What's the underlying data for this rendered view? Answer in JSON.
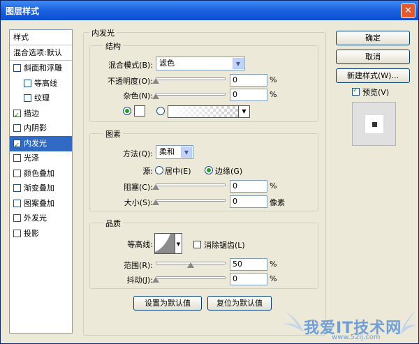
{
  "window": {
    "title": "图层样式",
    "close_glyph": "✕"
  },
  "style_list": {
    "header": "样式",
    "blend_default": "混合选项:默认",
    "items": [
      {
        "label": "斜面和浮雕",
        "checked": false,
        "selected": false,
        "indent": false
      },
      {
        "label": "等高线",
        "checked": false,
        "selected": false,
        "indent": true
      },
      {
        "label": "纹理",
        "checked": false,
        "selected": false,
        "indent": true
      },
      {
        "label": "描边",
        "checked": true,
        "selected": false,
        "indent": false
      },
      {
        "label": "内阴影",
        "checked": false,
        "selected": false,
        "indent": false
      },
      {
        "label": "内发光",
        "checked": true,
        "selected": true,
        "indent": false
      },
      {
        "label": "光泽",
        "checked": false,
        "selected": false,
        "indent": false
      },
      {
        "label": "颜色叠加",
        "checked": false,
        "selected": false,
        "indent": false
      },
      {
        "label": "渐变叠加",
        "checked": false,
        "selected": false,
        "indent": false
      },
      {
        "label": "图案叠加",
        "checked": false,
        "selected": false,
        "indent": false
      },
      {
        "label": "外发光",
        "checked": false,
        "selected": false,
        "indent": false
      },
      {
        "label": "投影",
        "checked": false,
        "selected": false,
        "indent": false
      }
    ]
  },
  "inner_glow": {
    "title": "内发光",
    "structure": {
      "title": "结构",
      "blend_mode_label": "混合模式(B):",
      "blend_mode_value": "滤色",
      "opacity_label": "不透明度(O):",
      "opacity_value": "0",
      "opacity_level": 0,
      "noise_label": "杂色(N):",
      "noise_value": "0",
      "noise_level": 0,
      "percent": "%"
    },
    "elements": {
      "title": "图素",
      "technique_label": "方法(Q):",
      "technique_value": "柔和",
      "source_label": "源:",
      "source_center": "居中(E)",
      "source_edge": "边缘(G)",
      "choke_label": "阻塞(C):",
      "choke_value": "0",
      "choke_level": 0,
      "size_label": "大小(S):",
      "size_value": "0",
      "size_level": 0,
      "size_unit": "像素",
      "percent": "%"
    },
    "quality": {
      "title": "品质",
      "contour_label": "等高线:",
      "anti_alias_label": "消除锯齿(L)",
      "range_label": "范围(R):",
      "range_value": "50",
      "range_level": 50,
      "jitter_label": "抖动(J):",
      "jitter_value": "0",
      "jitter_level": 0,
      "percent": "%"
    },
    "make_default": "设置为默认值",
    "reset_default": "复位为默认值"
  },
  "buttons": {
    "ok": "确定",
    "cancel": "取消",
    "new_style": "新建样式(W)...",
    "preview": "预览(V)"
  },
  "watermark": {
    "text": "我爱IT技术网",
    "url": "www.52ij.com"
  },
  "colors": {
    "title_blue": "#0b4fd2",
    "selection": "#316ac5",
    "watermark": "#6f9fd6"
  }
}
